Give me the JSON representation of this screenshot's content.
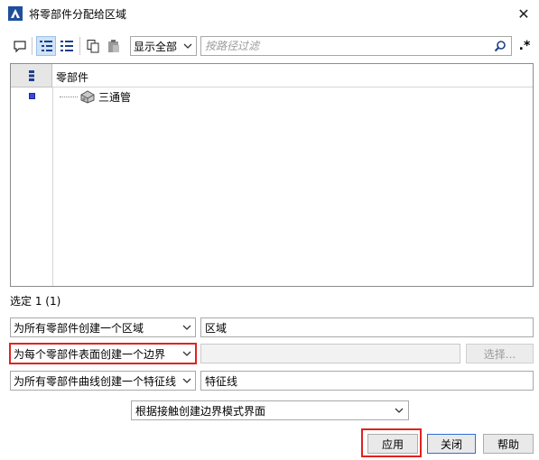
{
  "window": {
    "title": "将零部件分配给区域",
    "close_glyph": "✕"
  },
  "toolbar": {
    "show_filter_value": "显示全部",
    "filter_placeholder": "按路径过滤",
    "regex_label": ".*"
  },
  "tree": {
    "column_header": "零部件",
    "items": [
      {
        "label": "三通管"
      }
    ]
  },
  "selection_status": "选定 1 (1)",
  "rows": [
    {
      "option": "为所有零部件创建一个区域",
      "value": "区域"
    },
    {
      "option": "为每个零部件表面创建一个边界",
      "value": "",
      "button": "选择..."
    },
    {
      "option": "为所有零部件曲线创建一个特征线",
      "value": "特征线"
    }
  ],
  "mode_option": "根据接触创建边界模式界面",
  "buttons": {
    "apply": "应用",
    "close": "关闭",
    "help": "帮助"
  },
  "colors": {
    "highlight": "#e0221f",
    "active_toggle": "#cfe3f7",
    "primary_border": "#2f6fd6"
  }
}
